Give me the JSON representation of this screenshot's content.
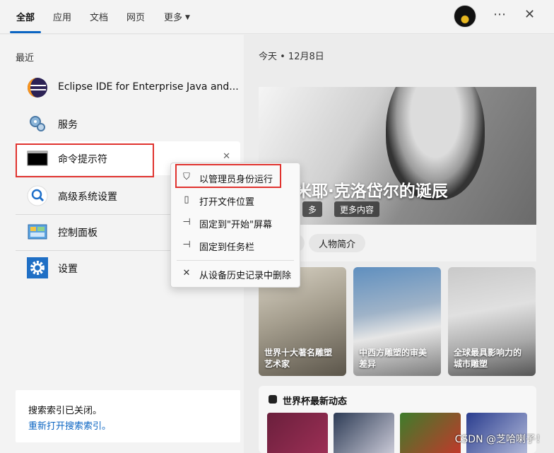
{
  "tabs": [
    {
      "label": "全部"
    },
    {
      "label": "应用"
    },
    {
      "label": "文档"
    },
    {
      "label": "网页"
    },
    {
      "label": "更多"
    }
  ],
  "top_icons": {
    "more": "⋯",
    "close": "✕"
  },
  "recent": {
    "label": "最近",
    "items": [
      {
        "label": "Eclipse IDE for Enterprise Java and...",
        "icon": "eclipse-icon"
      },
      {
        "label": "服务",
        "icon": "services-icon"
      },
      {
        "label": "命令提示符",
        "icon": "command-prompt-icon"
      },
      {
        "label": "高级系统设置",
        "icon": "advanced-settings-icon"
      },
      {
        "label": "控制面板",
        "icon": "control-panel-icon"
      },
      {
        "label": "设置",
        "icon": "settings-gear-icon"
      }
    ]
  },
  "search_index": {
    "status": "搜索索引已关闭。",
    "link": "重新打开搜索索引。"
  },
  "context_menu": {
    "items": [
      {
        "label": "以管理员身份运行",
        "icon": "shield-icon"
      },
      {
        "label": "打开文件位置",
        "icon": "folder-icon"
      },
      {
        "label": "固定到\"开始\"屏幕",
        "icon": "pin-icon"
      },
      {
        "label": "固定到任务栏",
        "icon": "pin-icon"
      },
      {
        "label": "从设备历史记录中删除",
        "icon": "close-icon"
      }
    ]
  },
  "right": {
    "date": "今天  •  12月8日",
    "hero_title": "米耶·克洛岱尔的诞辰",
    "hero_chip_1": "多",
    "hero_chip_2": "更多内容",
    "pill": "人物简介",
    "cards": [
      {
        "caption_line1": "世界十大著名雕塑",
        "caption_line2": "艺术家"
      },
      {
        "caption_line1": "中西方雕塑的审美",
        "caption_line2": "差异"
      },
      {
        "caption_line1": "全球最具影响力的",
        "caption_line2": "城市雕塑"
      }
    ],
    "world_cup_title": "世界杯最新动态"
  },
  "watermark": "CSDN @芝哈喇子！"
}
